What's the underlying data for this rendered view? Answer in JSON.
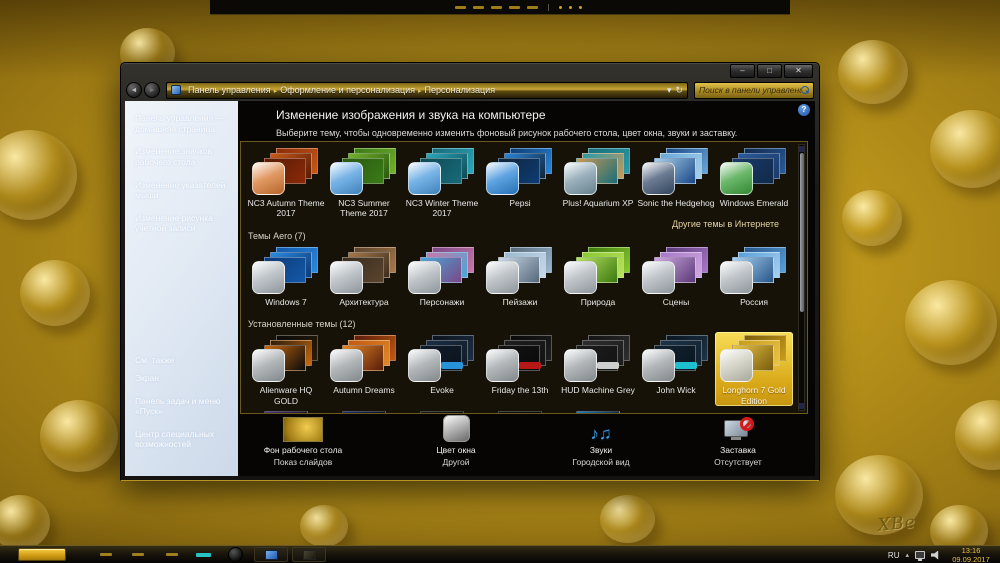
{
  "desktop": {
    "signature": "XBe"
  },
  "window": {
    "caption": {
      "minimize": "–",
      "maximize": "□",
      "close": "✕"
    },
    "nav": {
      "back_glyph": "◄",
      "forward_glyph": "►",
      "breadcrumb": [
        "Панель управления",
        "Оформление и персонализация",
        "Персонализация"
      ],
      "breadcrumb_separator": "▸",
      "dropdown_glyph": "▾",
      "refresh_glyph": "↻",
      "search_placeholder": "Поиск в панели управления"
    },
    "sidebar": {
      "items": [
        "Панель управления — домашняя страница",
        "Изменение значков рабочего стола",
        "Изменение указателей мыши",
        "Изменение рисунка учетной записи"
      ],
      "see_also_header": "См. также",
      "see_also_items": [
        "Экран",
        "Панель задач и меню «Пуск»",
        "Центр специальных возможностей"
      ]
    },
    "main": {
      "help_glyph": "?",
      "title": "Изменение изображения и звука на компьютере",
      "subtitle": "Выберите тему, чтобы одновременно изменить фоновый рисунок рабочего стола, цвет окна, звуки и заставку.",
      "online_themes_link": "Другие темы в Интернете",
      "sections": [
        {
          "header": "",
          "themes": [
            {
              "label": "NC3 Autumn Theme 2017",
              "stack": [
                "#8a2a08",
                "#c85a18",
                "#5a1a04"
              ],
              "glass": "#d87830"
            },
            {
              "label": "NC3 Summer Theme 2017",
              "stack": [
                "#3a7a18",
                "#74b02a",
                "#2a5a10"
              ],
              "glass": "#4a9ade"
            },
            {
              "label": "NC3 Winter Theme 2017",
              "stack": [
                "#186a7a",
                "#2aa8ba",
                "#0e4a56"
              ],
              "glass": "#4a9ade"
            },
            {
              "label": "Pepsi",
              "stack": [
                "#0c3d75",
                "#2a85d8",
                "#122438"
              ],
              "glass": "#2a85d8"
            },
            {
              "label": "Plus! Aquarium XP",
              "stack": [
                "#1a6e78",
                "#2a9aa8",
                "#c89858"
              ],
              "glass": "#7a98a8"
            },
            {
              "label": "Sonic the Hedgehog",
              "stack": [
                "#1a4888",
                "#6aa8d8",
                "#a8d0e8"
              ],
              "glass": "#3a506e"
            },
            {
              "label": "Windows Emerald",
              "stack": [
                "#102a4a",
                "#2a5a9a",
                "#1a3a6a"
              ],
              "glass": "#3aa03a"
            }
          ]
        },
        {
          "header": "Темы Aero (7)",
          "themes": [
            {
              "label": "Windows 7",
              "stack": [
                "#1458a8",
                "#2a8ae0",
                "#0c3a78"
              ],
              "glass": "#aab2b8"
            },
            {
              "label": "Архитектура",
              "stack": [
                "#5a442e",
                "#a87848",
                "#3a2c1e"
              ],
              "glass": "#aab2b8"
            },
            {
              "label": "Персонажи",
              "stack": [
                "#7a4888",
                "#c878a8",
                "#48a8d8"
              ],
              "glass": "#aab2b8"
            },
            {
              "label": "Пейзажи",
              "stack": [
                "#56697a",
                "#9ab8d0",
                "#c8d8e8"
              ],
              "glass": "#aab2b8"
            },
            {
              "label": "Природа",
              "stack": [
                "#3a7a0e",
                "#8cc832",
                "#b8e060"
              ],
              "glass": "#aab2b8"
            },
            {
              "label": "Сцены",
              "stack": [
                "#5a3a78",
                "#a878c8",
                "#d0a8e0"
              ],
              "glass": "#aab2b8"
            },
            {
              "label": "Россия",
              "stack": [
                "#28568a",
                "#58a0d8",
                "#a8d0f0"
              ],
              "glass": "#aab2b8"
            }
          ]
        },
        {
          "header": "Установленные темы (12)",
          "themes": [
            {
              "label": "Alienware HQ GOLD",
              "stack": [
                "#0a0a0a",
                "#2a1c08",
                "#c86a10"
              ],
              "glass": "#9aa0a4"
            },
            {
              "label": "Autumn Dreams",
              "stack": [
                "#5a1c08",
                "#c05a14",
                "#e08828"
              ],
              "glass": "#9aa0a4"
            },
            {
              "label": "Evoke",
              "stack": [
                "#0c141e",
                "#1c2e44",
                "#101c2a"
              ],
              "glass": "#9aa0a4",
              "badge": "#2a9ae0"
            },
            {
              "label": "Friday the 13th",
              "stack": [
                "#0a0a0a",
                "#1e1e1e",
                "#141414"
              ],
              "glass": "#9aa0a4",
              "badge": "#c01818"
            },
            {
              "label": "HUD Machine Grey",
              "stack": [
                "#141414",
                "#2e2e2e",
                "#1c1c1c"
              ],
              "glass": "#9aa0a4",
              "badge": "#d8d8d8"
            },
            {
              "label": "John Wick",
              "stack": [
                "#0a1622",
                "#1c3448",
                "#122230"
              ],
              "glass": "#9aa0a4",
              "badge": "#20c8d8"
            },
            {
              "label": "Longhorn 7 Gold Edition",
              "stack": [
                "#7a5c0c",
                "#c89c1c",
                "#e8c448"
              ],
              "glass": "#c8c8b8",
              "selected": true
            }
          ]
        }
      ],
      "partial_row_colors": [
        "#4a3080",
        "#1c2a66",
        "#181818",
        "#101010",
        "#1878c8"
      ],
      "sounds_glyph": "♪♫",
      "footer_items": [
        {
          "icon": "desktop-background-icon",
          "title": "Фон рабочего стола",
          "value": "Показ слайдов"
        },
        {
          "icon": "window-color-icon",
          "title": "Цвет окна",
          "value": "Другой"
        },
        {
          "icon": "sounds-icon",
          "title": "Звуки",
          "value": "Городской вид"
        },
        {
          "icon": "screensaver-icon",
          "title": "Заставка",
          "value": "Отсутствует"
        }
      ]
    }
  },
  "taskbar": {
    "tray": {
      "language": "RU",
      "hidden_icons_glyph": "▴",
      "time": "13:16",
      "date": "09.09.2017"
    }
  }
}
